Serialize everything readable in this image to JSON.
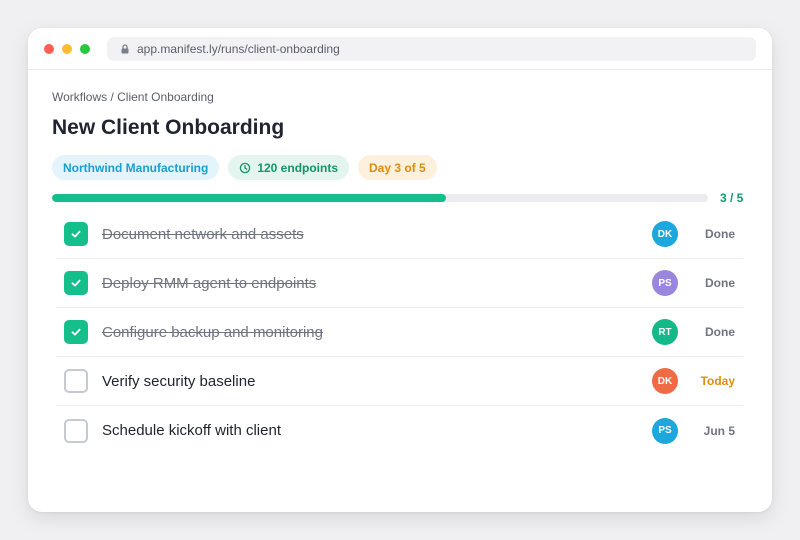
{
  "browser": {
    "url": "app.manifest.ly/runs/client-onboarding"
  },
  "page": {
    "breadcrumb": "Workflows / Client Onboarding",
    "title": "New Client Onboarding"
  },
  "chips": {
    "client": "Northwind Manufacturing",
    "endpoints": "120 endpoints",
    "day": "Day 3 of 5"
  },
  "progress": {
    "label": "3 / 5",
    "completed": 3,
    "total": 5,
    "fraction": 0.6
  },
  "colors": {
    "accent_green": "#14bf8b",
    "today_orange": "#de8d0c",
    "client_blue": "#1a9fd1"
  },
  "tasks": [
    {
      "label": "Document network and assets",
      "done": true,
      "assignee": "DK",
      "avatar_color": "#1ea7dc",
      "status": "Done",
      "status_color": "#6f7480"
    },
    {
      "label": "Deploy RMM agent to endpoints",
      "done": true,
      "assignee": "PS",
      "avatar_color": "#9a86de",
      "status": "Done",
      "status_color": "#6f7480"
    },
    {
      "label": "Configure backup and monitoring",
      "done": true,
      "assignee": "RT",
      "avatar_color": "#14b889",
      "status": "Done",
      "status_color": "#6f7480"
    },
    {
      "label": "Verify security baseline",
      "done": false,
      "assignee": "DK",
      "avatar_color": "#f06a45",
      "status": "Today",
      "status_color": "#de8d0c"
    },
    {
      "label": "Schedule kickoff with client",
      "done": false,
      "assignee": "PS",
      "avatar_color": "#1ea7dc",
      "status": "Jun 5",
      "status_color": "#6f7480"
    }
  ],
  "icons": {
    "lock": "lock-icon",
    "clock": "clock-icon",
    "check": "check-icon"
  }
}
